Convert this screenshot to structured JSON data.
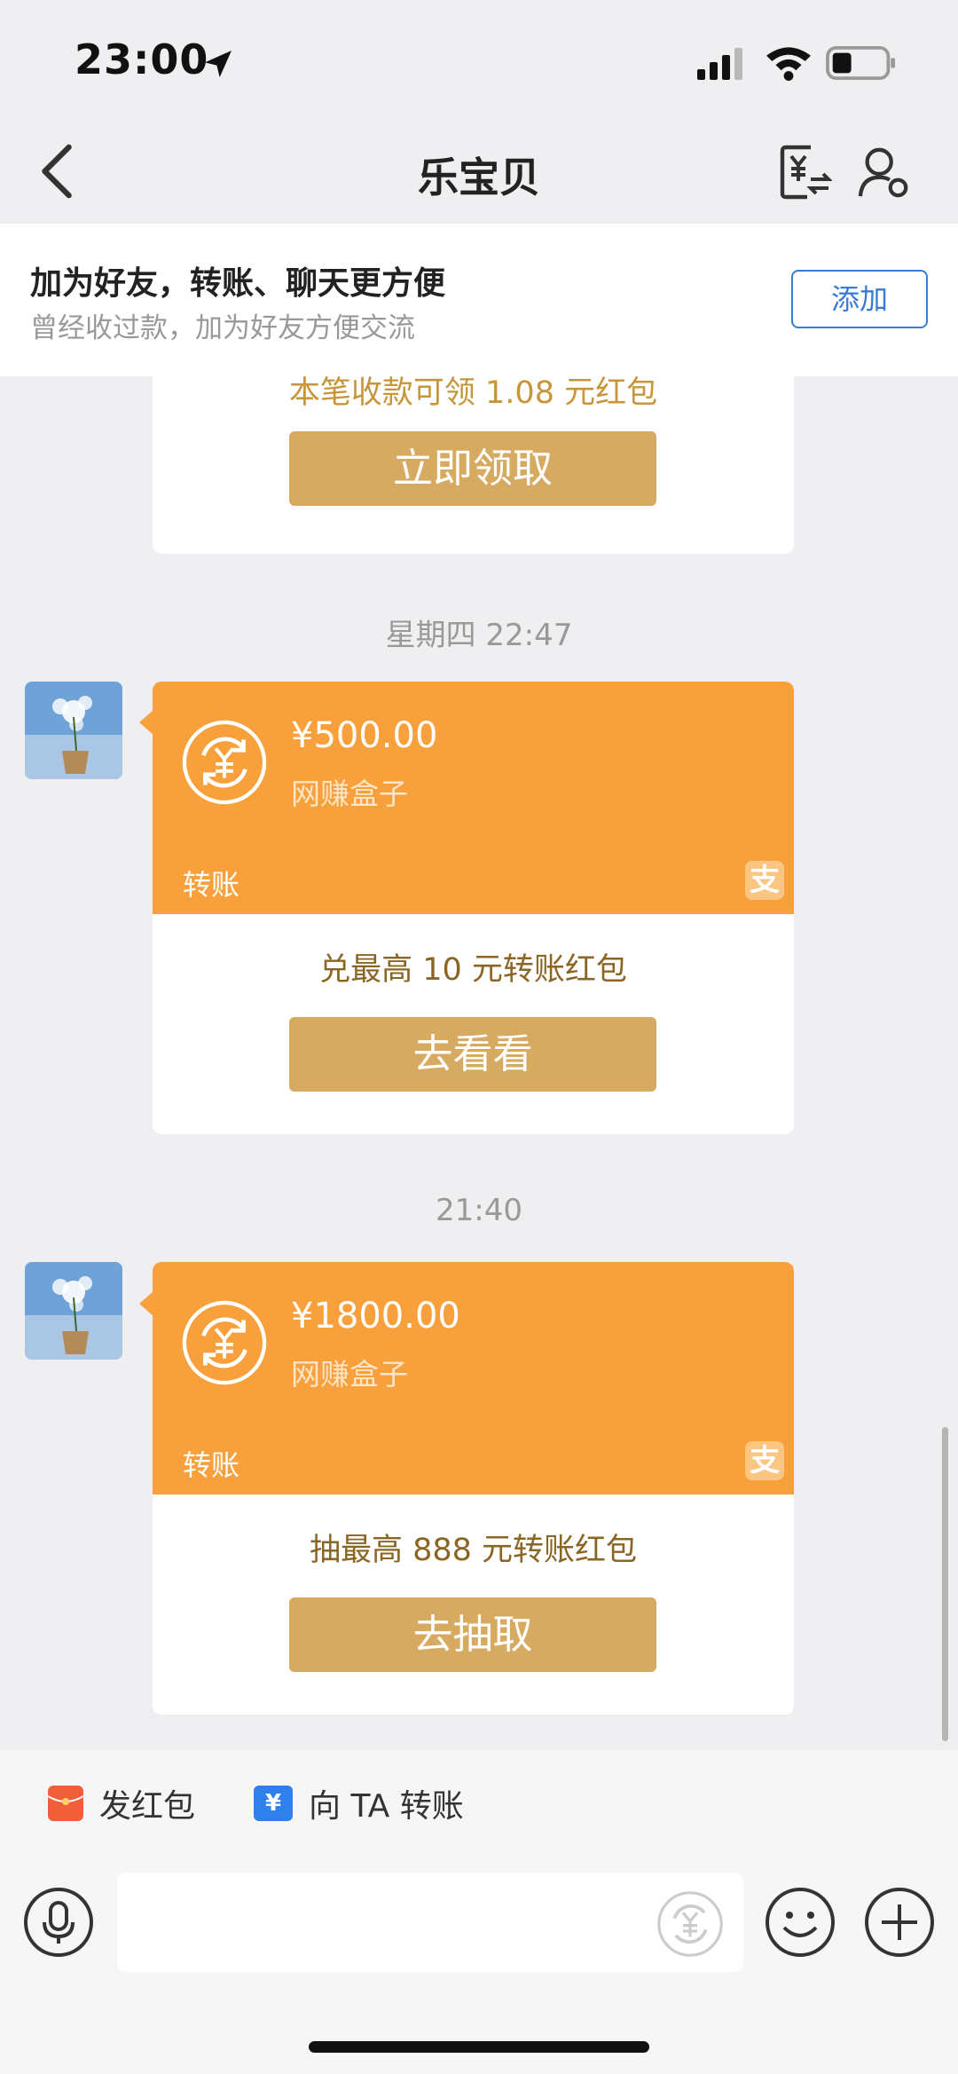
{
  "status_bar": {
    "time": "23:00"
  },
  "nav": {
    "title": "乐宝贝"
  },
  "banner": {
    "title": "加为好友，转账、聊天更方便",
    "subtitle": "曾经收过款，加为好友方便交流",
    "add_label": "添加"
  },
  "partial_card": {
    "promo": "本笔收款可领 1.08 元红包",
    "button": "立即领取"
  },
  "messages": [
    {
      "timestamp": "星期四 22:47",
      "amount": "¥500.00",
      "from": "网赚盒子",
      "type_label": "转账",
      "badge": "支",
      "promo": "兑最高 10 元转账红包",
      "button": "去看看"
    },
    {
      "timestamp": "21:40",
      "amount": "¥1800.00",
      "from": "网赚盒子",
      "type_label": "转账",
      "badge": "支",
      "promo": "抽最高 888 元转账红包",
      "button": "去抽取"
    }
  ],
  "quick_actions": {
    "red_packet": "发红包",
    "transfer": "向 TA 转账",
    "transfer_icon": "¥"
  },
  "colors": {
    "orange": "#f8a03b",
    "gold": "#d6aa61",
    "link_blue": "#3a7bd5"
  },
  "icons": [
    "location-arrow-icon",
    "signal-icon",
    "wifi-icon",
    "battery-icon",
    "back-chevron-icon",
    "transfer-icon",
    "contact-settings-icon",
    "coin-exchange-icon",
    "alipay-icon",
    "red-packet-icon",
    "microphone-icon",
    "smile-icon",
    "plus-icon"
  ]
}
